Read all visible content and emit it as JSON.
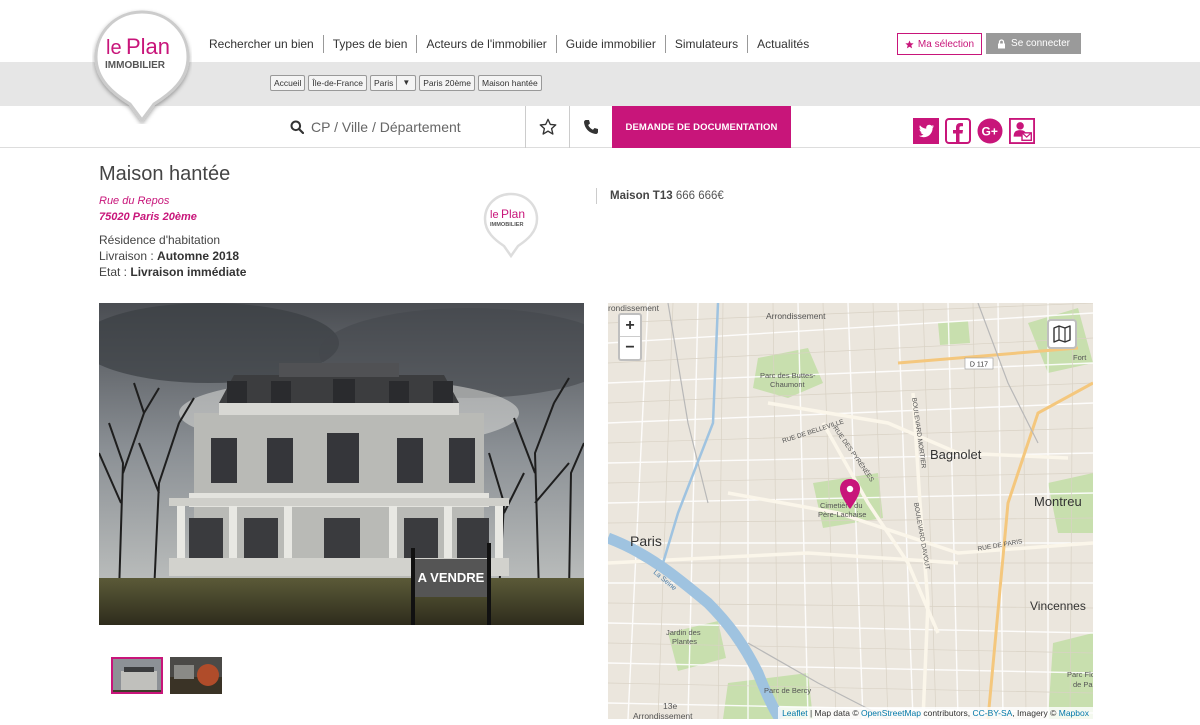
{
  "logo": {
    "line1": "le",
    "line2": "Plan",
    "line3": "IMMOBILIER"
  },
  "nav": [
    "Rechercher un bien",
    "Types de bien",
    "Acteurs de l'immobilier",
    "Guide immobilier",
    "Simulateurs",
    "Actualités"
  ],
  "header": {
    "selection_label": "Ma sélection",
    "login_label": "Se connecter"
  },
  "breadcrumb": [
    "Accueil",
    "Île-de-France",
    "Paris",
    "Paris 20ème",
    "Maison hantée"
  ],
  "search": {
    "placeholder": "CP / Ville / Département"
  },
  "cta": {
    "doc_label": "DEMANDE DE DOCUMENTATION"
  },
  "colors": {
    "accent": "#c8157a",
    "gray_bar": "#e6e6e6"
  },
  "icons": {
    "search": "search-icon",
    "favorite": "star-icon",
    "phone": "phone-icon",
    "twitter": "twitter-icon",
    "facebook": "facebook-icon",
    "googleplus": "google-plus-icon",
    "contact": "contact-icon"
  },
  "listing": {
    "title": "Maison hantée",
    "street": "Rue du Repos",
    "city": "75020 Paris 20ème",
    "type": "Résidence d'habitation",
    "delivery_label": "Livraison : ",
    "delivery_value": "Automne 2018",
    "state_label": "Etat : ",
    "state_value": "Livraison immédiate",
    "price_type": "Maison T13",
    "price_value": "666 666€"
  },
  "photo": {
    "sign_text": "A VENDRE"
  },
  "map": {
    "zoom_in": "+",
    "zoom_out": "−",
    "labels": {
      "arr_top": "Arrondissement",
      "arr_top2": "rondissement",
      "buttes": "Parc des Buttes-",
      "buttes2": "Chaumont",
      "belleville": "RUE DE BELLEVILLE",
      "pyrenees": "RUE DES PYRÉNÉES",
      "mortier": "BOULEVARD MORTIER",
      "davout": "BOULEVARD DAVOUT",
      "bagnolet": "Bagnolet",
      "montreuil": "Montreu",
      "cimetiere1": "Cimetière du",
      "cimetiere2": "Père-Lachaise",
      "paris": "Paris",
      "ruedeparis": "RUE DE PARIS",
      "vincennes": "Vincennes",
      "jardin1": "Jardin des",
      "jardin2": "Plantes",
      "bercy": "Parc de Bercy",
      "d117": "D 117",
      "fort": "Fort",
      "seine": "La Seine",
      "parcflo": "Parc Flo",
      "parcflo2": "de Par",
      "arr13": "13e",
      "arr_bottom": "Arrondissement"
    },
    "attribution": {
      "leaflet": "Leaflet",
      "text1": " | Map data © ",
      "osm": "OpenStreetMap",
      "text2": " contributors, ",
      "cc": "CC-BY-SA",
      "text3": ", Imagery © ",
      "mapbox": "Mapbox"
    }
  }
}
